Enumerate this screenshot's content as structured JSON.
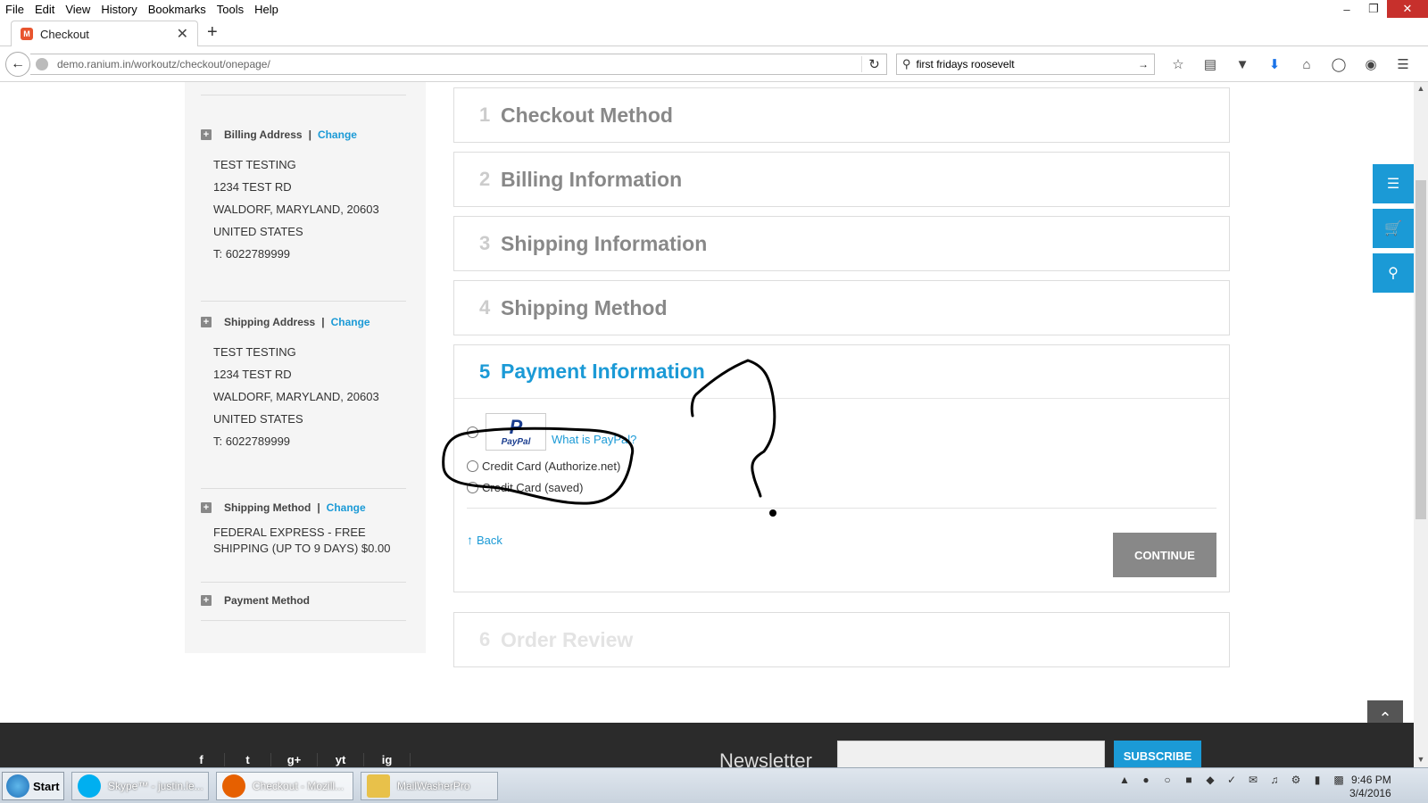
{
  "browser": {
    "menu": [
      "File",
      "Edit",
      "View",
      "History",
      "Bookmarks",
      "Tools",
      "Help"
    ],
    "tab_title": "Checkout",
    "url": "demo.ranium.in/workoutz/checkout/onepage/",
    "search_value": "first fridays roosevelt"
  },
  "sidebar": {
    "billing": {
      "title": "Billing Address",
      "change": "Change",
      "lines": [
        "TEST TESTING",
        "1234 TEST RD",
        "WALDORF, MARYLAND, 20603",
        "UNITED STATES",
        "T: 6022789999"
      ]
    },
    "shipping": {
      "title": "Shipping Address",
      "change": "Change",
      "lines": [
        "TEST TESTING",
        "1234 TEST RD",
        "WALDORF, MARYLAND, 20603",
        "UNITED STATES",
        "T: 6022789999"
      ]
    },
    "shipping_method": {
      "title": "Shipping Method",
      "change": "Change",
      "lines": [
        "FEDERAL EXPRESS - FREE",
        "SHIPPING (UP TO 9 DAYS) $0.00"
      ]
    },
    "payment_method": {
      "title": "Payment Method"
    }
  },
  "steps": [
    {
      "num": "1",
      "label": "Checkout Method"
    },
    {
      "num": "2",
      "label": "Billing Information"
    },
    {
      "num": "3",
      "label": "Shipping Information"
    },
    {
      "num": "4",
      "label": "Shipping Method"
    },
    {
      "num": "5",
      "label": "Payment Information"
    },
    {
      "num": "6",
      "label": "Order Review"
    }
  ],
  "payment": {
    "paypal_logo_text": "PayPal",
    "what_paypal": "What is PayPal?",
    "options": [
      "Credit Card (Authorize.net)",
      "Credit Card (saved)"
    ],
    "back": "Back",
    "continue": "CONTINUE"
  },
  "footer": {
    "newsletter": "Newsletter",
    "subscribe": "SUBSCRIBE",
    "social": [
      "f",
      "t",
      "g+",
      "yt",
      "ig"
    ]
  },
  "taskbar": {
    "start": "Start",
    "tasks": [
      "Skype™ - justin.le...",
      "Checkout - Mozill...",
      "MailWasherPro"
    ],
    "time": "9:46 PM",
    "date": "3/4/2016"
  },
  "colors": {
    "accent": "#1b9ad6",
    "button_gray": "#888888",
    "footer": "#2b2b2b"
  }
}
